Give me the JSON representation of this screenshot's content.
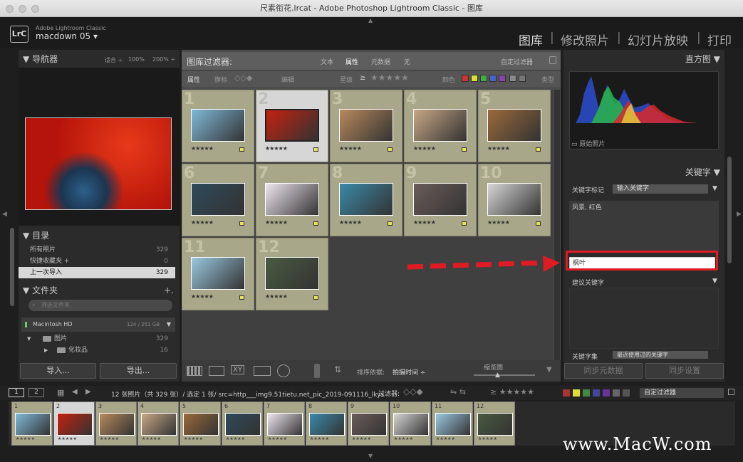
{
  "window": {
    "title": "尺素衔花.lrcat - Adobe Photoshop Lightroom Classic - 图库"
  },
  "identity": {
    "app_name": "Adobe Lightroom Classic",
    "catalog": "macdown 05",
    "logo": "LrC"
  },
  "modules": [
    "图库",
    "修改照片",
    "幻灯片放映",
    "打印"
  ],
  "navigator": {
    "title": "导航器",
    "zooms": [
      "适合 ÷",
      "100%",
      "200% ÷"
    ]
  },
  "catalog": {
    "title": "目录",
    "items": [
      {
        "label": "所有照片",
        "count": "329"
      },
      {
        "label": "快捷收藏夹 +",
        "count": "0"
      },
      {
        "label": "上一次导入",
        "count": "329"
      }
    ]
  },
  "folders": {
    "title": "文件夹",
    "search_placeholder": "筛选文件夹",
    "volume": "Macintosh HD",
    "volume_size": "124 / 251 GB",
    "tree": [
      {
        "label": "图片",
        "count": "329"
      },
      {
        "label": "化妆品",
        "count": "16"
      }
    ]
  },
  "left_buttons": {
    "import": "导入...",
    "export": "导出..."
  },
  "filter": {
    "title": "图库过滤器:",
    "tabs": [
      "文本",
      "属性",
      "元数据",
      "无"
    ],
    "preset": "自定过滤器",
    "row2_label": "属性",
    "flag_label": "旗标",
    "edit_label": "编辑",
    "rating_label": "星级",
    "color_label": "颜色",
    "kind_label": "类型",
    "rating_op": "≥"
  },
  "grid": {
    "cells": [
      {
        "num": "1",
        "color": "#7fb9d8"
      },
      {
        "num": "2",
        "color": "#c4210f"
      },
      {
        "num": "3",
        "color": "#b88a5c"
      },
      {
        "num": "4",
        "color": "#c7a785"
      },
      {
        "num": "5",
        "color": "#9a6a3a"
      },
      {
        "num": "6",
        "color": "#2e4a5a"
      },
      {
        "num": "7",
        "color": "#efe6ee"
      },
      {
        "num": "8",
        "color": "#3a8aa8"
      },
      {
        "num": "9",
        "color": "#6a5d5a"
      },
      {
        "num": "10",
        "color": "#d6d6d6"
      },
      {
        "num": "11",
        "color": "#9ac8e0"
      },
      {
        "num": "12",
        "color": "#4a5a40"
      }
    ],
    "stars": "★★★★★"
  },
  "center_toolbar": {
    "sort_label": "排序依据:",
    "sort_value": "拍摄时间 ÷",
    "thumb_label": "缩览图"
  },
  "right": {
    "histogram_title": "直方图",
    "original_photo": "原始照片",
    "keywords_title": "关键字",
    "kw_tag_label": "关键字标记",
    "kw_tag_value": "输入关键字",
    "kw_list": "风景, 红色",
    "kw_input": "枫叶",
    "suggest_title": "建议关键字",
    "kw_set_label": "关键字集",
    "kw_set_value": "最近使用过的关键字",
    "sync_meta": "同步元数据",
    "sync_settings": "同步设置"
  },
  "filmbar": {
    "pages": [
      "1",
      "2"
    ],
    "info": "12 张照片（共 329 张）/ 选定 1 张/ src=http___img9.51tietu.net_pic_2019-091116_lkys",
    "filter_label": "过滤器:",
    "preset": "自定过滤器"
  },
  "filmstrip": {
    "nums": [
      "1",
      "2",
      "3",
      "4",
      "5",
      "6",
      "7",
      "8",
      "9",
      "10",
      "11",
      "12"
    ],
    "stars": "★★★★★"
  },
  "watermark": "www.MacW.com"
}
